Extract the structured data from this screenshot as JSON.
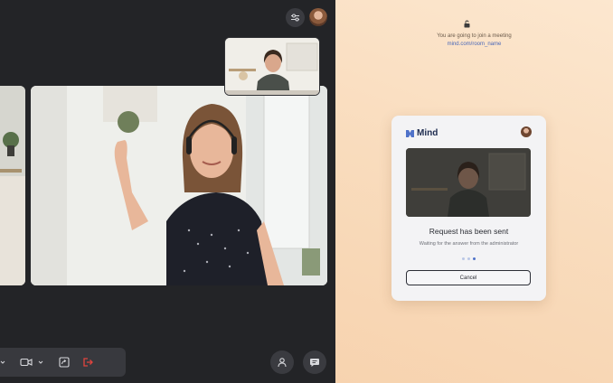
{
  "meeting": {
    "toolbar_colors": {
      "leave": "#e0443e",
      "icon": "#d8d9dd"
    }
  },
  "invite": {
    "join_message": "You are going to join a meeting",
    "room_url": "mind.com/room_name",
    "card": {
      "brand": "Mind",
      "status_title": "Request has been sent",
      "status_subtitle": "Waiting for the answer from the administrator",
      "progress_dots": 3,
      "active_dot": 3,
      "cancel_label": "Cancel"
    }
  },
  "colors": {
    "accent": "#4f72c9",
    "peach_background": "#f9dcbd",
    "dark_background": "#232427"
  }
}
